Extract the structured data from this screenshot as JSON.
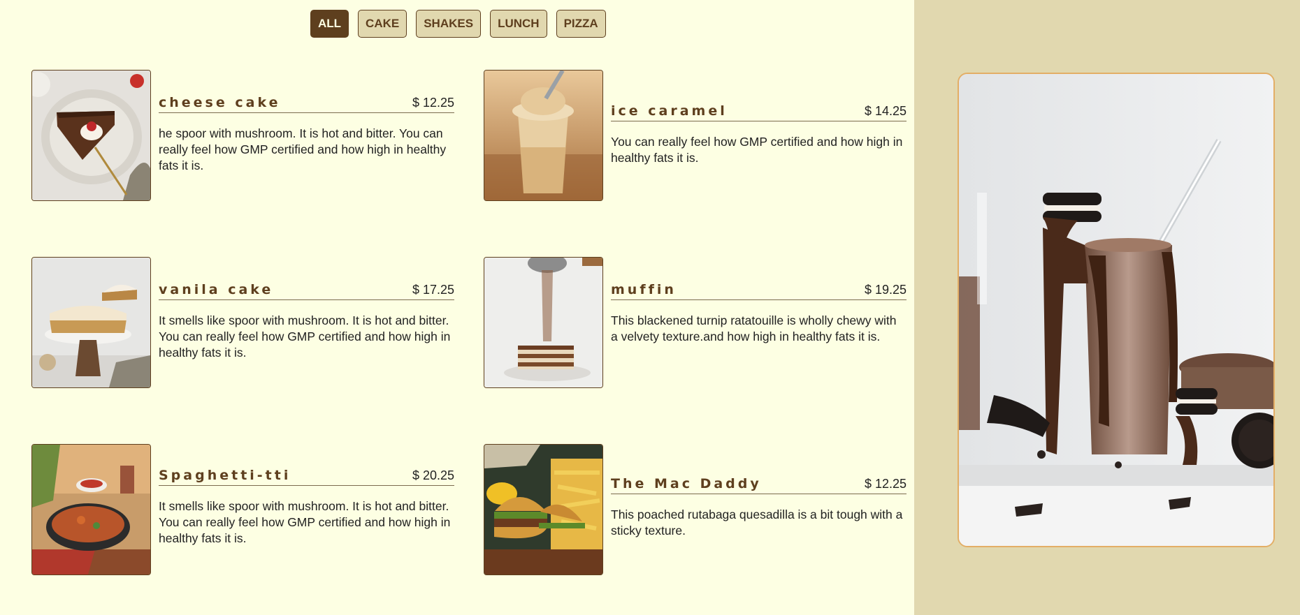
{
  "filters": [
    {
      "label": "ALL",
      "active": true
    },
    {
      "label": "CAKE",
      "active": false
    },
    {
      "label": "SHAKES",
      "active": false
    },
    {
      "label": "LUNCH",
      "active": false
    },
    {
      "label": "PIZZA",
      "active": false
    }
  ],
  "menu": [
    {
      "name": "cheese cake",
      "price": "$ 12.25",
      "desc": "he spoor with mushroom. It is hot and bitter. You can really feel how GMP certified and how high in healthy fats it is."
    },
    {
      "name": "ice caramel",
      "price": "$ 14.25",
      "desc": "You can really feel how GMP certified and how high in healthy fats it is."
    },
    {
      "name": "vanila cake",
      "price": "$ 17.25",
      "desc": "It smells like spoor with mushroom. It is hot and bitter. You can really feel how GMP certified and how high in healthy fats it is."
    },
    {
      "name": "muffin",
      "price": "$ 19.25",
      "desc": "This blackened turnip ratatouille is wholly chewy with a velvety texture.and how high in healthy fats it is."
    },
    {
      "name": "Spaghetti-tti",
      "price": "$ 20.25",
      "desc": "It smells like spoor with mushroom. It is hot and bitter. You can really feel how GMP certified and how high in healthy fats it is."
    },
    {
      "name": "The Mac Daddy",
      "price": "$ 12.25",
      "desc": "This poached rutabaga quesadilla is a bit tough with a sticky texture."
    }
  ],
  "colors": {
    "page_bg": "#fdffe3",
    "panel_bg": "#e1d8af",
    "accent_brown": "#5e3f1e",
    "frame_border": "#e3ae66"
  },
  "images": {
    "feature": "chocolate-milkshake-photo",
    "thumbs": [
      "chocolate-tart-photo",
      "caramel-drink-photo",
      "meringue-pie-photo",
      "cocoa-dusted-cake-photo",
      "pasta-skillet-photo",
      "burger-fries-photo"
    ]
  }
}
